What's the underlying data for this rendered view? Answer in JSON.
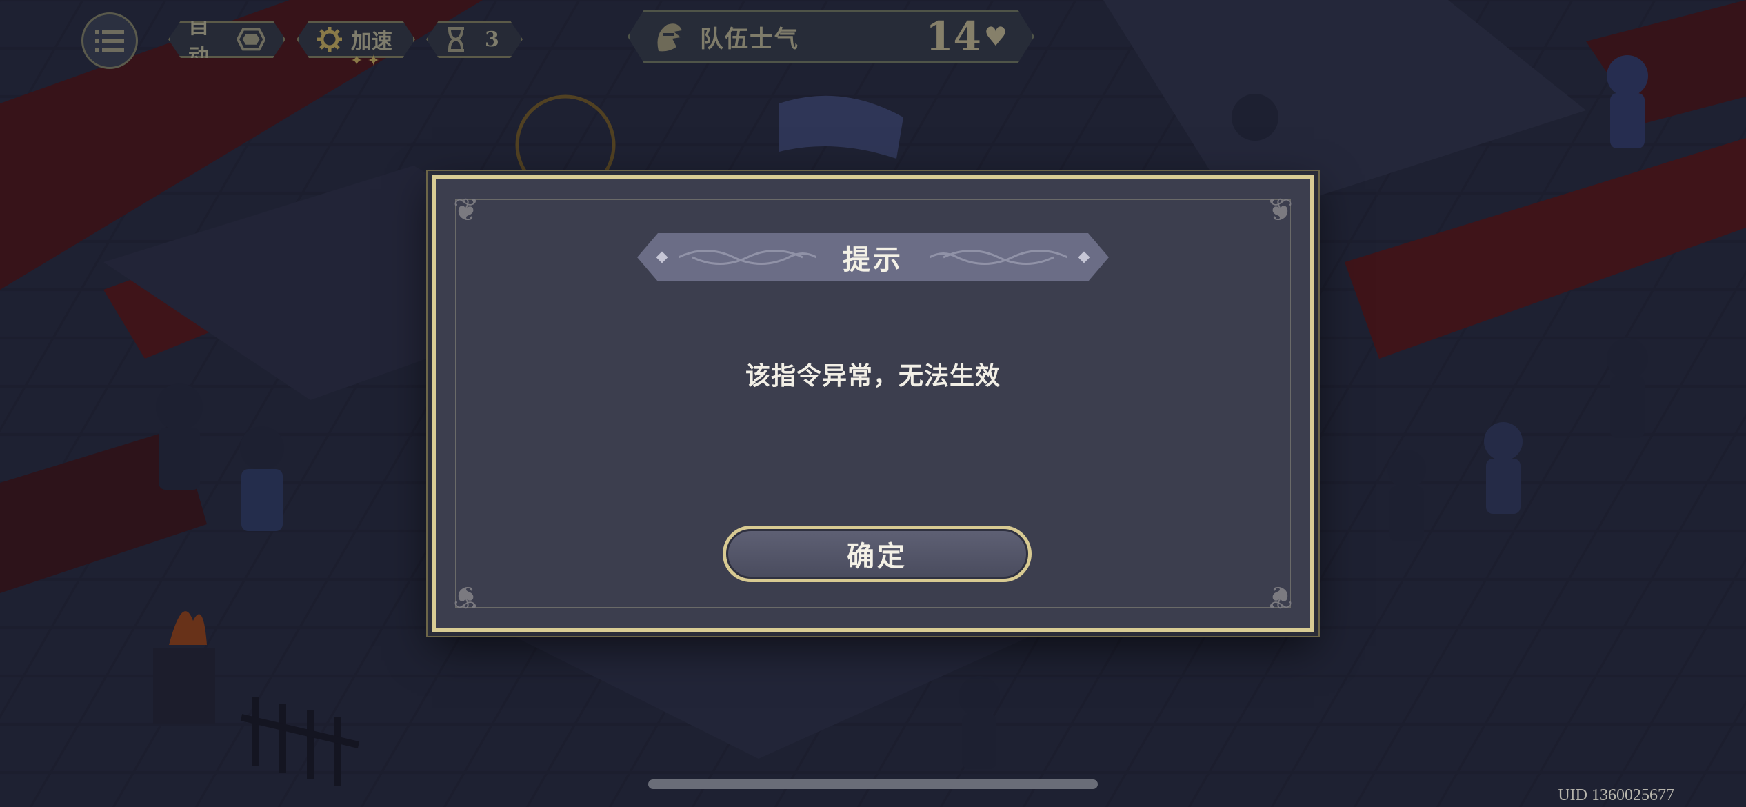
{
  "hud": {
    "auto_label": "自动",
    "speed_label": "加速",
    "speed_stars": "✦✦",
    "timer_value": "3",
    "morale_label": "队伍士气",
    "morale_value": "14",
    "heart_symbol": "♥"
  },
  "dialog": {
    "title": "提示",
    "message": "该指令异常，无法生效",
    "confirm_label": "确定"
  },
  "footer": {
    "uid": "UID 1360025677"
  },
  "icons": {
    "menu": "list-icon",
    "auto": "hexagon-icon",
    "speed": "gear-icon",
    "timer": "hourglass-icon",
    "morale": "knight-helmet-icon",
    "heart": "heart-icon"
  },
  "colors": {
    "dialog_border": "#d9cc94",
    "dialog_bg": "#3c3e4e",
    "title_plate": "#6b6d86",
    "lava_red": "#7a1e1e"
  }
}
